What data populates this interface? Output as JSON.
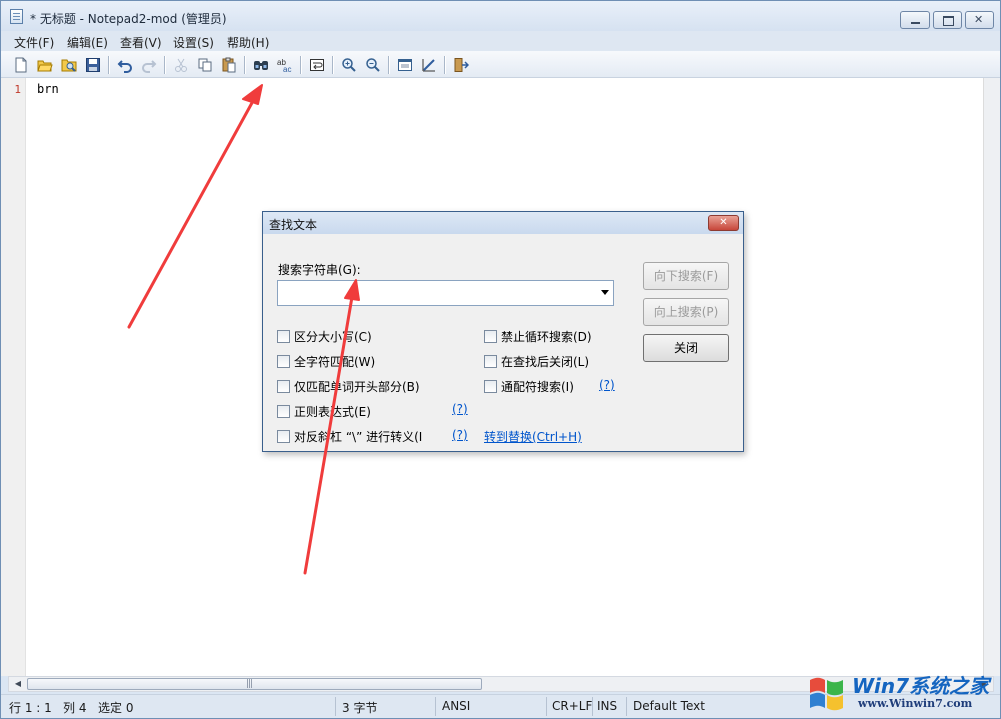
{
  "window": {
    "title": "* 无标题 - Notepad2-mod (管理员)"
  },
  "menu": {
    "items": [
      "文件(F)",
      "编辑(E)",
      "查看(V)",
      "设置(S)",
      "帮助(H)"
    ]
  },
  "toolbar": {
    "buttons": [
      "new-file-icon",
      "open-file-icon",
      "browse-icon",
      "save-icon",
      "undo-icon",
      "redo-icon",
      "cut-icon",
      "copy-icon",
      "paste-icon",
      "find-icon",
      "replace-icon",
      "word-wrap-icon",
      "zoom-in-icon",
      "zoom-out-icon",
      "scheme-icon",
      "customize-icon",
      "exit-icon"
    ]
  },
  "editor": {
    "line_number": "1",
    "text": "brn"
  },
  "statusbar": {
    "position": "行 1 : 1",
    "column": "列 4",
    "selection": "选定 0",
    "size": "3 字节",
    "encoding": "ANSI",
    "eol": "CR+LF",
    "mode": "INS",
    "scheme": "Default Text"
  },
  "find_dialog": {
    "title": "查找文本",
    "search_label": "搜索字符串(G):",
    "search_value": "",
    "options_left": [
      {
        "label": "区分大小写(C)",
        "checked": false
      },
      {
        "label": "全字符匹配(W)",
        "checked": false
      },
      {
        "label": "仅匹配单词开头部分(B)",
        "checked": false
      },
      {
        "label": "正则表达式(E)",
        "checked": false
      },
      {
        "label": "对反斜杠 “\\” 进行转义(I",
        "checked": false
      }
    ],
    "options_right": [
      {
        "label": "禁止循环搜索(D)",
        "checked": false
      },
      {
        "label": "在查找后关闭(L)",
        "checked": false
      },
      {
        "label": "通配符搜索(I)",
        "checked": false
      }
    ],
    "help_link": "(?)",
    "goto_replace": "转到替换(Ctrl+H)",
    "btn_find_next": "向下搜索(F)",
    "btn_find_prev": "向上搜索(P)",
    "btn_close": "关闭"
  },
  "watermark": {
    "brand": "Win7系统之家",
    "url": "www.Winwin7.com"
  },
  "colors": {
    "annotation_arrow": "#f03c3c",
    "link": "#0055cc",
    "line_number": "#c0392b"
  }
}
